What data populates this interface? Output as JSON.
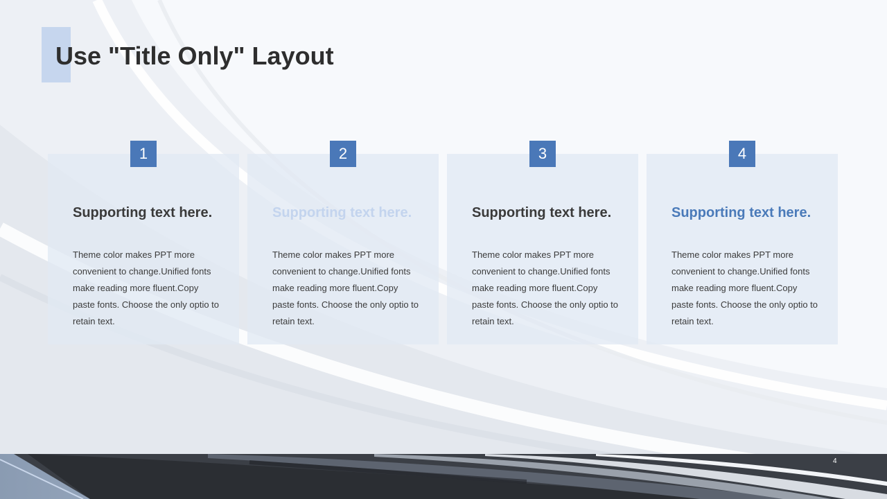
{
  "slide": {
    "title": "Use \"Title Only\" Layout",
    "page_number": "4"
  },
  "cards": [
    {
      "number": "1",
      "heading": "Supporting text here.",
      "body": "Theme color makes PPT more convenient  to change.Unified  fonts make reading more fluent.Copy paste fonts. Choose the only optio to retain text.",
      "heading_color": "#3a3a3a"
    },
    {
      "number": "2",
      "heading": "Supporting text here.",
      "body": "Theme color makes PPT more convenient  to change.Unified  fonts make reading more fluent.Copy paste fonts. Choose the only optio to retain text.",
      "heading_color": "#c3d4ee"
    },
    {
      "number": "3",
      "heading": "Supporting text here.",
      "body": "Theme color makes PPT more convenient  to change.Unified  fonts make reading more fluent.Copy paste fonts. Choose the only optio to retain text.",
      "heading_color": "#3a3a3a"
    },
    {
      "number": "4",
      "heading": "Supporting text here.",
      "body": "Theme color makes PPT more convenient  to change.Unified  fonts make reading more fluent.Copy paste fonts. Choose the only optio to retain text.",
      "heading_color": "#4a7ab9"
    }
  ],
  "colors": {
    "accent": "#4a78b8",
    "title_accent_block": "#c6d6ee",
    "card_background": "#e3e9f3",
    "title_text": "#2e2e2e"
  }
}
